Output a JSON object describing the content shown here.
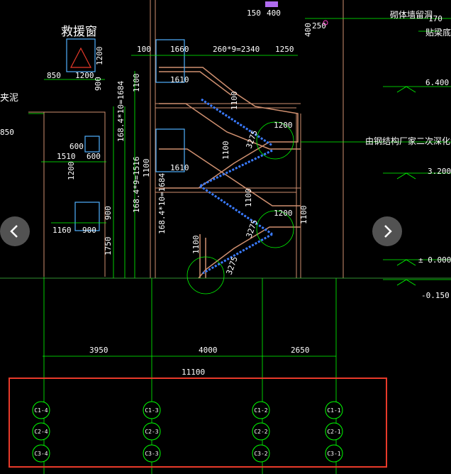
{
  "title_window": "救援窗",
  "notes": {
    "masonry": "砌体墙留洞",
    "masonry_2": "贴梁底",
    "steel": "由钢结构厂家二次深化设计",
    "left_partial": "夹泥"
  },
  "dims": {
    "d150": "150",
    "d400": "400",
    "d250": "250",
    "d400v": "400",
    "d170": "170",
    "d100": "100",
    "d1660": "1660",
    "d2340": "260*9=2340",
    "d1250": "1250",
    "d850": "850",
    "d1200": "1200",
    "d1200v": "1200",
    "d900v": "900",
    "d1100a": "1100",
    "d1610a": "1610",
    "d1100b": "1100",
    "d1684a": "168.4*10=1684",
    "d1200c": "1200",
    "d3275a": "3275",
    "d850b": "850",
    "d600a": "600",
    "d1510": "1510",
    "d600b": "600",
    "d1200d": "1200",
    "d1516": "168.4*9=1516",
    "d1100c": "1100",
    "d1610b": "1610",
    "d1100d": "1100",
    "d1684b": "168.4*10=1684",
    "d1200e": "1200",
    "d3275b": "3275",
    "d1160": "1160",
    "d900": "900",
    "d900b": "900",
    "d1750": "1750",
    "d1100e": "1100",
    "d1100f": "1100",
    "d3275c": "3275",
    "d3950": "3950",
    "d4000": "4000",
    "d2650": "2650",
    "d11100": "11100"
  },
  "levels": [
    {
      "label": "6.400"
    },
    {
      "label": "3.200"
    },
    {
      "label": "± 0.000"
    },
    {
      "label": "-0.150"
    }
  ],
  "axes": [
    {
      "r1": "C1-4",
      "r2": "C2-4",
      "r3": "C3-4"
    },
    {
      "r1": "C1-3",
      "r2": "C2-3",
      "r3": "C3-3"
    },
    {
      "r1": "C1-2",
      "r2": "C2-2",
      "r3": "C3-2"
    },
    {
      "r1": "C1-1",
      "r2": "C2-1",
      "r3": "C3-1"
    }
  ],
  "colors": {
    "background": "#000000",
    "dimension": "#00ff00",
    "text": "#ffffff",
    "wall": "#d09070",
    "window": "#4fb0ff",
    "stair": "#3a7bff",
    "grid": "#ffff7f",
    "highlight": "#e83a2a"
  },
  "navigation": {
    "prev_icon": "chevron-left-icon",
    "next_icon": "chevron-right-icon"
  }
}
